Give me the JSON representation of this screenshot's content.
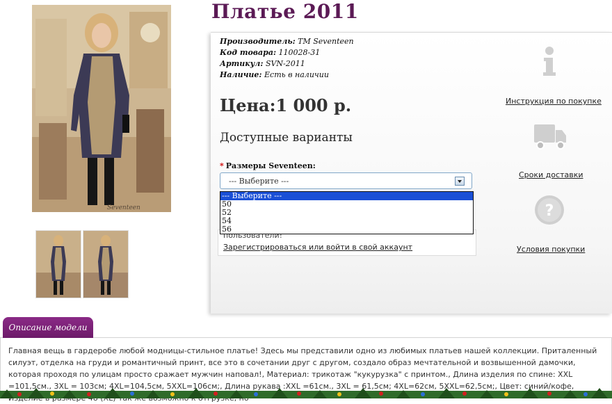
{
  "product": {
    "title": "Платье 2011",
    "meta": [
      {
        "label": "Производитель:",
        "value": "TM Seventeen"
      },
      {
        "label": "Код товара:",
        "value": "110028-31"
      },
      {
        "label": "Артикул:",
        "value": "SVN-2011"
      },
      {
        "label": "Наличие:",
        "value": "Есть в наличии"
      }
    ],
    "price": "Цена:1 000 р.",
    "variants_heading": "Доступные варианты",
    "size_label": "Размеры Seventeen:",
    "size_required_mark": "*",
    "select_value": "--- Выберите ---",
    "size_options": [
      "--- Выберите ---",
      "50",
      "52",
      "54",
      "56"
    ],
    "photo_watermark": "Seventeen"
  },
  "login": {
    "note": "пользователи!",
    "link": "Зарегистрироваться или войти в свой аккаунт"
  },
  "side": {
    "instruction": "Инструкция по покупке",
    "delivery": "Сроки доставки",
    "conditions": "Условия покупки"
  },
  "description": {
    "tab": "Описание модели",
    "text": "Главная вещь в гардеробе любой модницы-стильное платье! Здесь мы представили одно из любимых платьев нашей коллекции. Приталенный силуэт, отделка на груди и романтичный принт, все это в сочетании друг с другом, создало образ мечтательной и возвышенной дамочки, которая проходя по улицам просто сражает мужчин наповал!, Материал: трикотаж \"кукурузка\" с принтом., Длина изделия по спине: XXL =101,5см., 3XL = 103см; 4XL=104,5см, 5XXL=106см;, Длина рукава :XXL =61см., 3XL = 61,5см; 4XL=62см, 5XXL=62,5см;, Цвет: синий/кофе, Изделие в размере 48 (XL) так же возможно к отгрузке, но"
  },
  "colors": {
    "title": "#5b1a55",
    "tab": "#7a2276",
    "select_highlight": "#1a4fd6",
    "dress_dark": "#3c3a55"
  }
}
